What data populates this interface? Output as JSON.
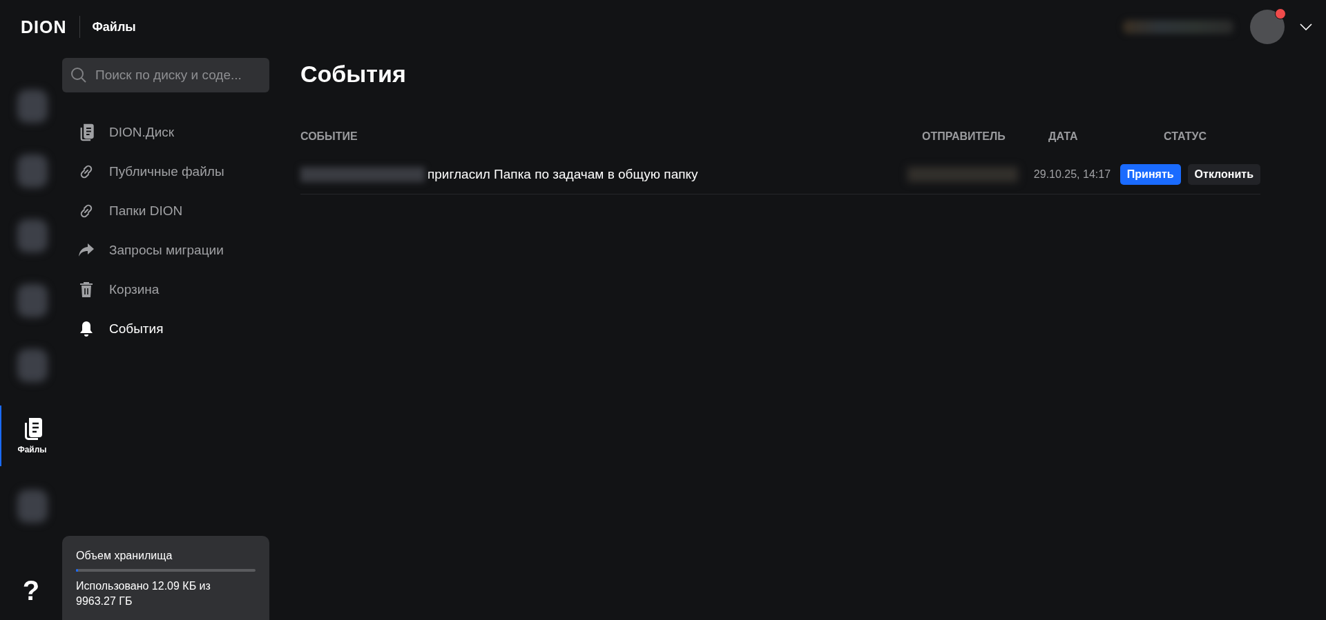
{
  "header": {
    "logo": "DION",
    "app_title": "Файлы",
    "account": {
      "notification": true
    }
  },
  "rail": {
    "items": [
      {
        "kind": "blurred",
        "selected": false
      },
      {
        "kind": "blurred",
        "selected": false
      },
      {
        "kind": "blurred",
        "selected": false
      },
      {
        "kind": "blurred",
        "selected": false
      },
      {
        "kind": "blurred",
        "selected": false
      },
      {
        "kind": "files",
        "label": "Файлы",
        "selected": true
      },
      {
        "kind": "blurred",
        "selected": false
      }
    ],
    "help": "?"
  },
  "sidebar": {
    "search": {
      "placeholder": "Поиск по диску и соде..."
    },
    "items": [
      {
        "kind": "docs",
        "label": "DION.Диск",
        "selected": false
      },
      {
        "kind": "link",
        "label": "Публичные файлы",
        "selected": false
      },
      {
        "kind": "link",
        "label": "Папки DION",
        "selected": false
      },
      {
        "kind": "share",
        "label": "Запросы миграции",
        "selected": false
      },
      {
        "kind": "trash",
        "label": "Корзина",
        "selected": false
      },
      {
        "kind": "bell",
        "label": "События",
        "selected": true
      }
    ],
    "storage": {
      "title": "Объем хранилища",
      "level": 0,
      "text": "Использовано 12.09 КБ из 9963.27 ГБ"
    }
  },
  "page": {
    "title": "События",
    "table": {
      "columns": [
        "СОБЫТИЕ",
        "ОТПРАВИТЕЛЬ",
        "ДАТА",
        "СТАТУС"
      ],
      "rows": [
        {
          "event": "пригласил Папка по задачам в общую папку",
          "date": "29.10.25, 14:17",
          "actions": [
            {
              "kind": "primary",
              "label": "Принять"
            },
            {
              "kind": "secondary",
              "label": "Отклонить"
            }
          ]
        }
      ]
    }
  }
}
